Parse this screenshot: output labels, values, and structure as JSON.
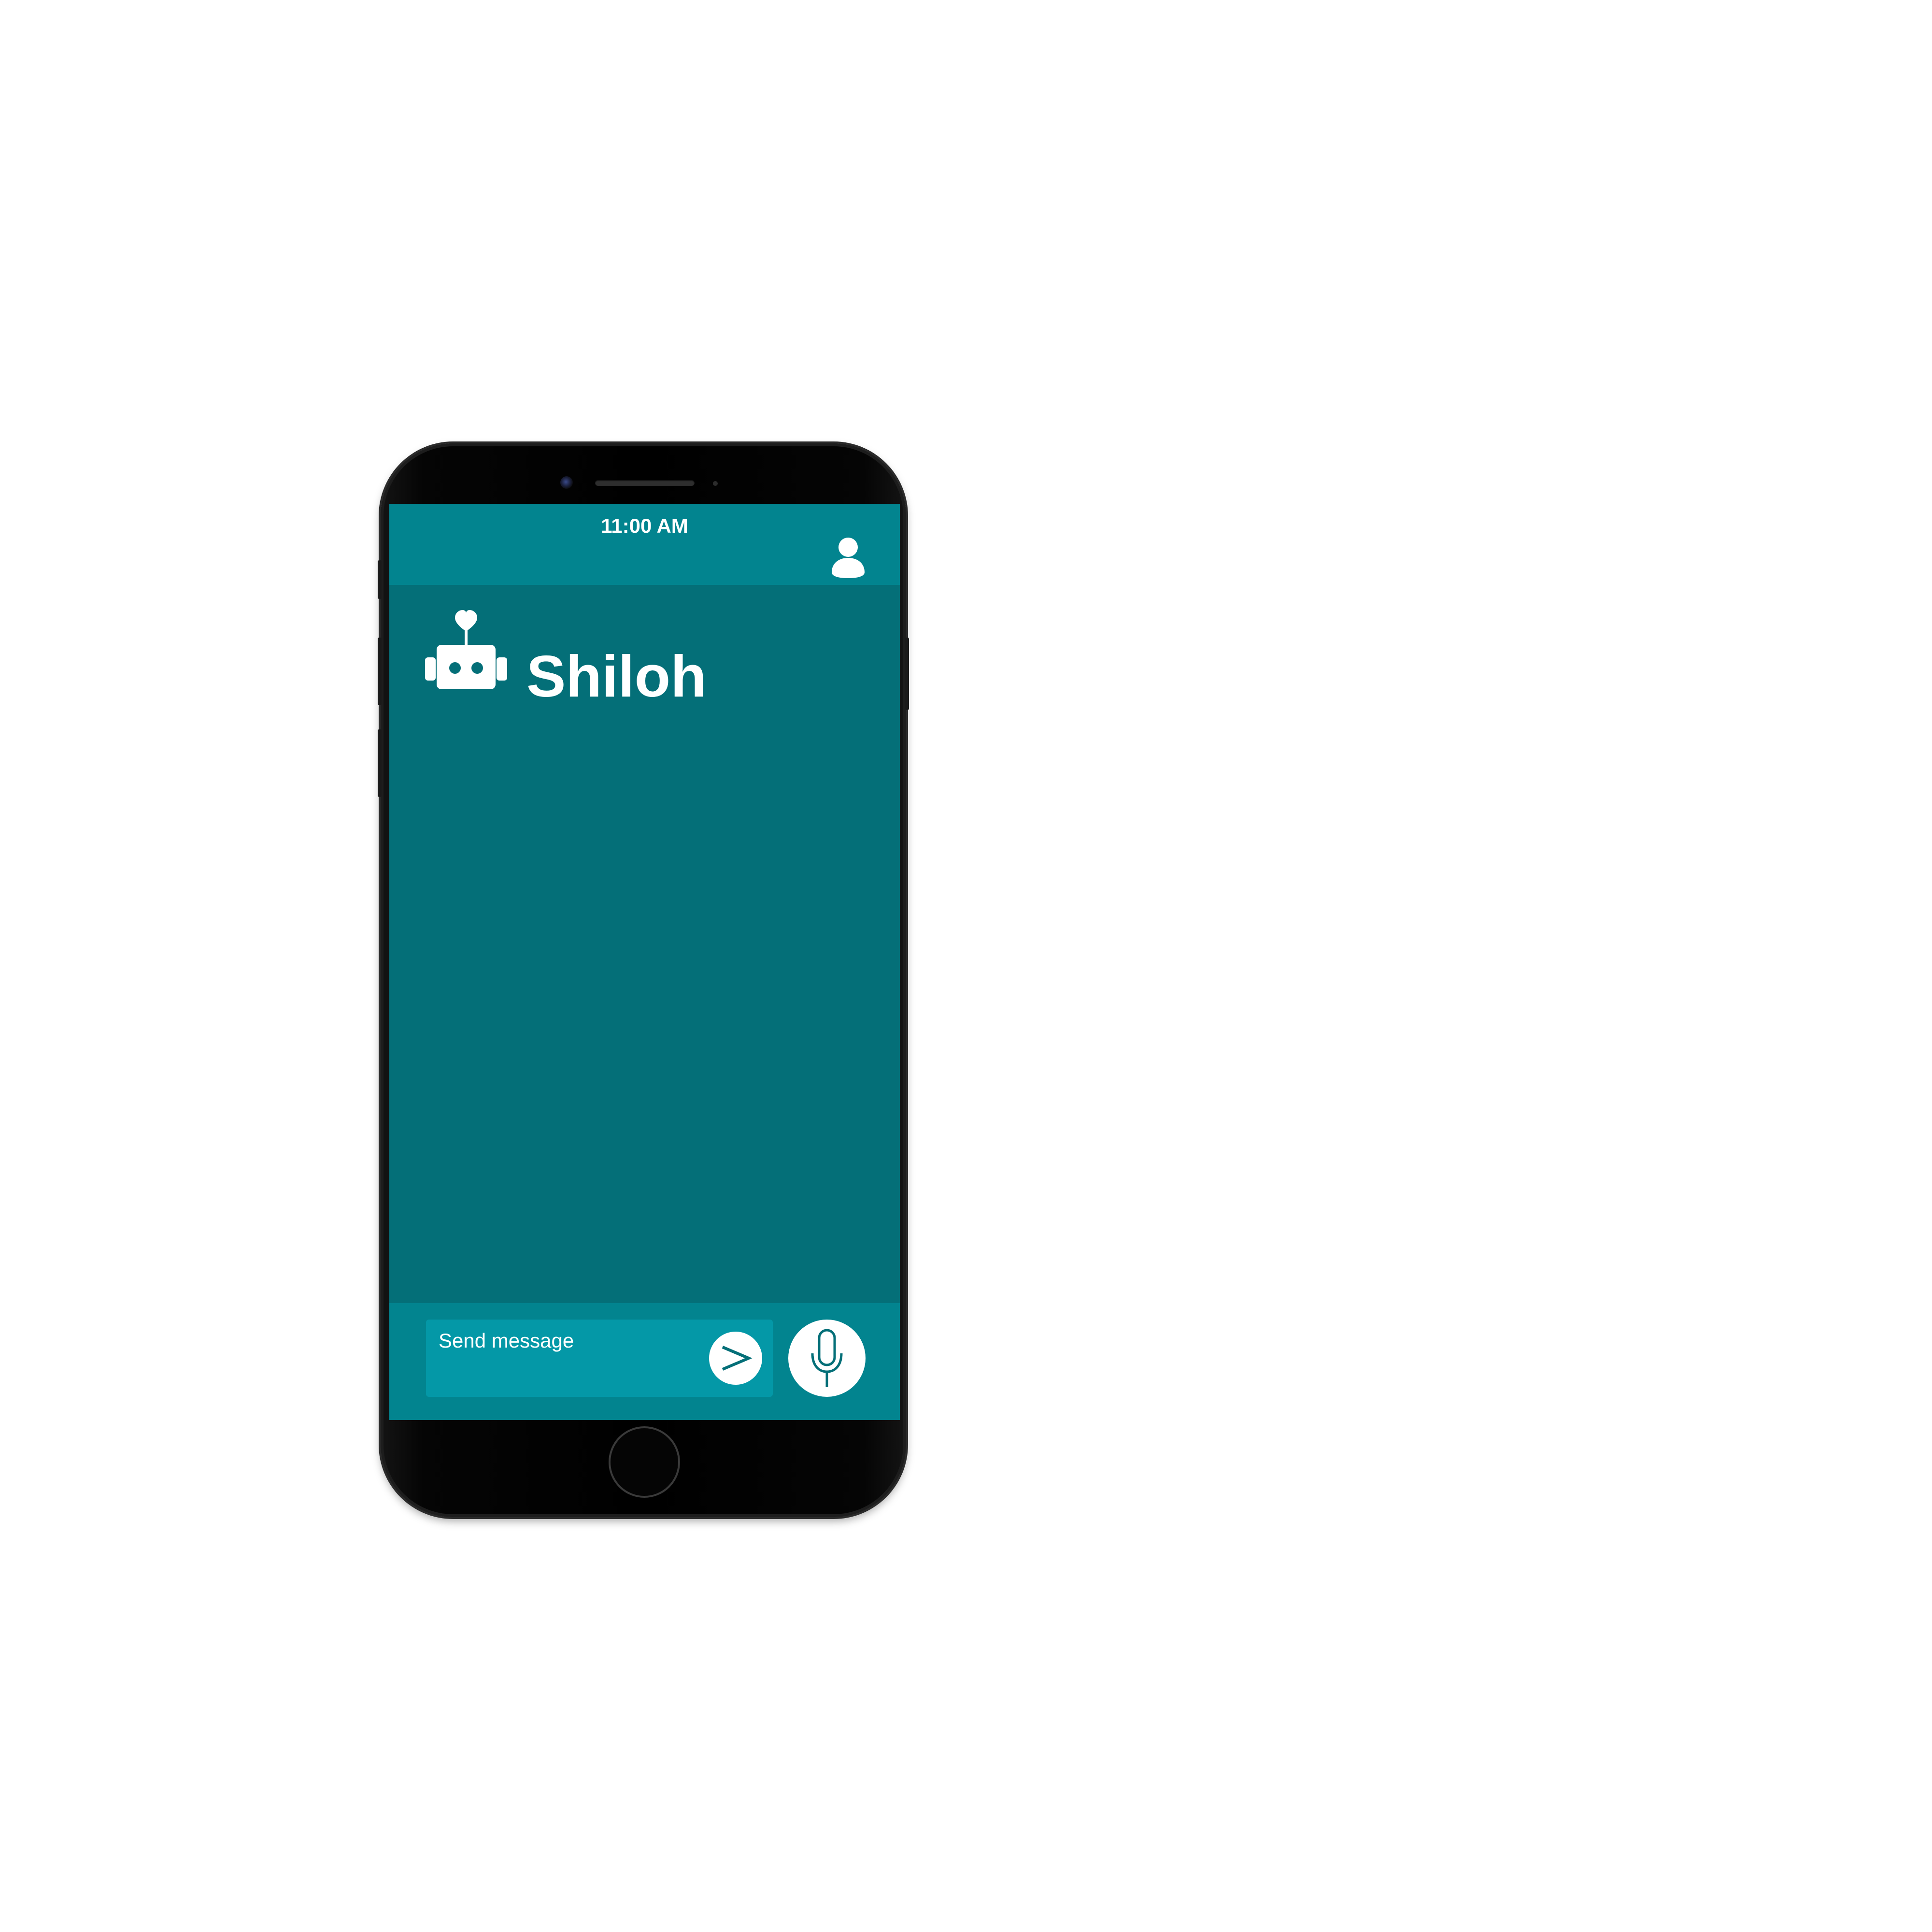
{
  "status_bar": {
    "time": "11:00 AM",
    "profile_icon": "user-icon"
  },
  "chat_header": {
    "bot_icon": "robot-heart-icon",
    "bot_name": "Shiloh"
  },
  "composer": {
    "placeholder": "Send message",
    "send_icon": "send-chevron-icon",
    "mic_icon": "microphone-icon"
  },
  "colors": {
    "status_bar": "#02848f",
    "chat_background": "#046f78",
    "composer_bar": "#02848f",
    "message_box": "#0498a7",
    "icon_stroke": "#046f78",
    "text": "#ffffff",
    "device_body": "#000000"
  }
}
